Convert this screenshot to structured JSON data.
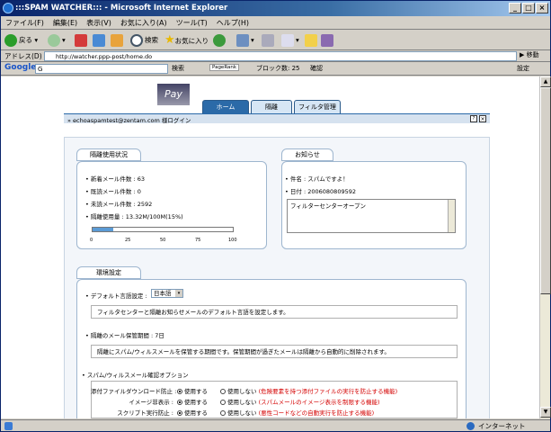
{
  "window": {
    "title": ":::SPAM WATCHER::: - Microsoft Internet Explorer"
  },
  "menu": [
    "ファイル(F)",
    "編集(E)",
    "表示(V)",
    "お気に入り(A)",
    "ツール(T)",
    "ヘルプ(H)"
  ],
  "toolbar": {
    "back": "戻る",
    "search": "検索",
    "favorites": "お気に入り"
  },
  "address": {
    "label": "アドレス(D)",
    "url": "http://watcher.ppp-post/home.do",
    "go": "移動"
  },
  "google": {
    "label": "Google",
    "input": "G",
    "search": "検索",
    "pagerank": "PageRank",
    "blocked": "ブロック数: 25",
    "check": "確認",
    "settings": "設定"
  },
  "header": {
    "logo": "Pay",
    "tabs": [
      "ホーム",
      "隔離",
      "フィルタ管理"
    ],
    "user": "» echoaspamtest@zentam.com 様ログイン"
  },
  "usage": {
    "title": "隔離使用状況",
    "rows": [
      "新着メール件数 : 63",
      "既読メール件数 : 0",
      "未読メール件数 : 2592",
      "隔離使用量 : 13.32M/100M(15%)"
    ],
    "percent": 15,
    "ticks": [
      "0",
      "25",
      "50",
      "75",
      "100"
    ]
  },
  "notice": {
    "title": "お知らせ",
    "subject": "件名 : スパムですよ！",
    "date": "日付 : 2006080809592",
    "body": "フィルターセンターオープン"
  },
  "settings": {
    "title": "環境設定",
    "lang_label": "デフォルト言語設定 :",
    "lang_value": "日本語",
    "lang_desc": "フィルタセンターと隔離お知らせメールのデフォルト言語を設定します。",
    "retention": "隔離のメール保管期間 : 7日",
    "retention_desc": "隔離にスパム/ウィルスメールを保管する期間です。保管期間が過ぎたメールは隔離から自動的に削除されます。",
    "options_label": "スパム/ウィルスメール確認オプション",
    "options": [
      {
        "label": "添付ファイルダウンロード防止 :",
        "on": "使用する",
        "off": "使用しない",
        "note": "(危険要素を持つ添付ファイルの実行を防止する機能)"
      },
      {
        "label": "イメージ非表示 :",
        "on": "使用する",
        "off": "使用しない",
        "note": "(スパムメールのイメージ表示を制限する機能)"
      },
      {
        "label": "スクリプト実行防止 :",
        "on": "使用する",
        "off": "使用しない",
        "note": "(悪性コードなどの自動実行を防止する機能)"
      }
    ]
  },
  "status": {
    "zone": "インターネット"
  }
}
